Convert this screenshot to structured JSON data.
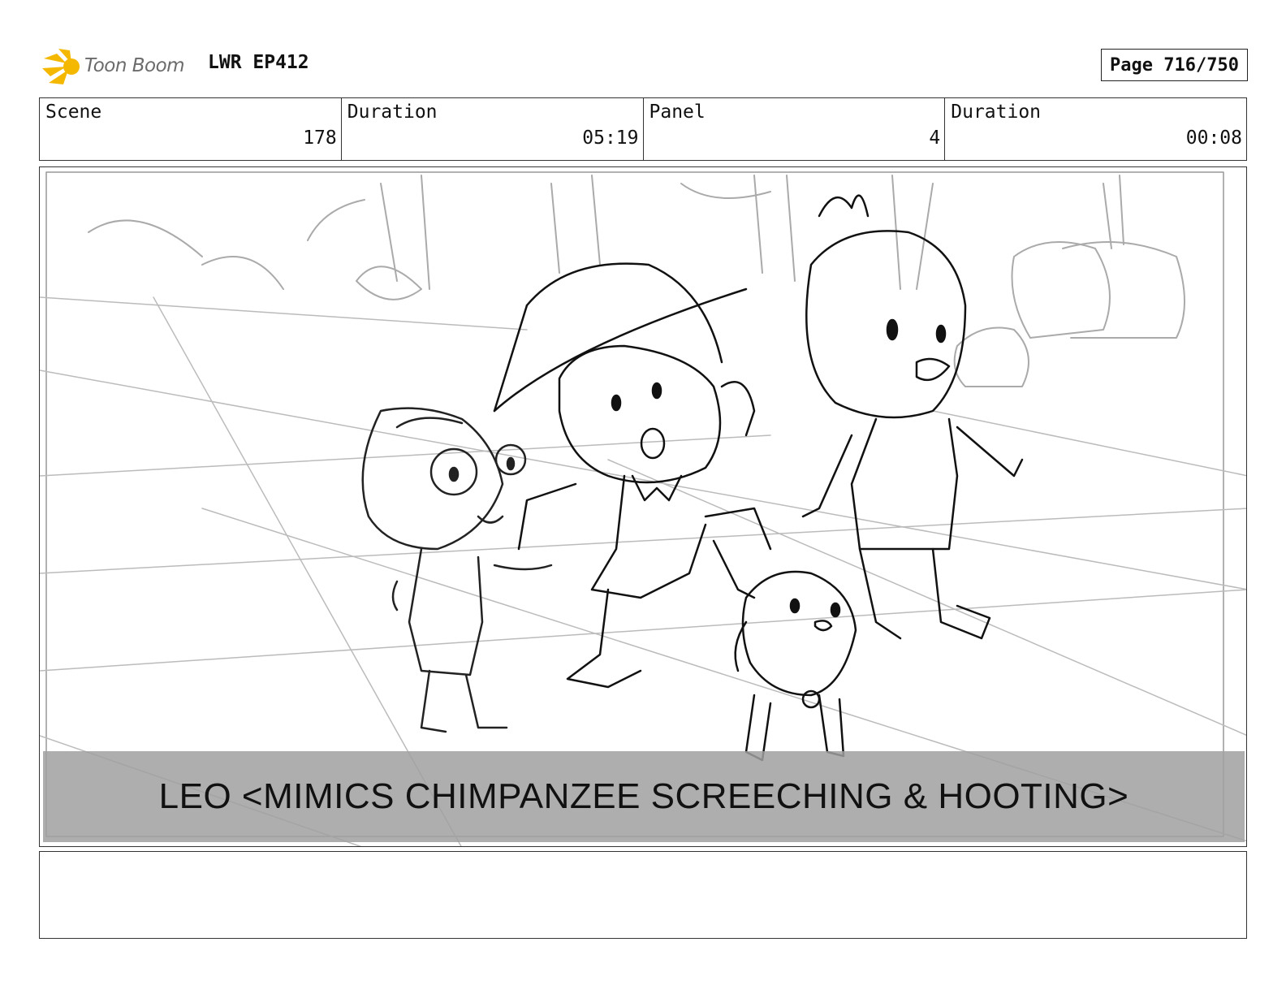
{
  "header": {
    "brand": "Toon Boom",
    "project": "LWR EP412",
    "page": "Page 716/750"
  },
  "info": {
    "scene_label": "Scene",
    "scene_value": "178",
    "scene_duration_label": "Duration",
    "scene_duration_value": "05:19",
    "panel_label": "Panel",
    "panel_value": "4",
    "panel_duration_label": "Duration",
    "panel_duration_value": "00:08"
  },
  "panel": {
    "caption": "LEO <MIMICS CHIMPANZEE SCREECHING & HOOTING>"
  },
  "colors": {
    "logo_accent": "#f5b800",
    "caption_band": "#a0a0a0"
  }
}
